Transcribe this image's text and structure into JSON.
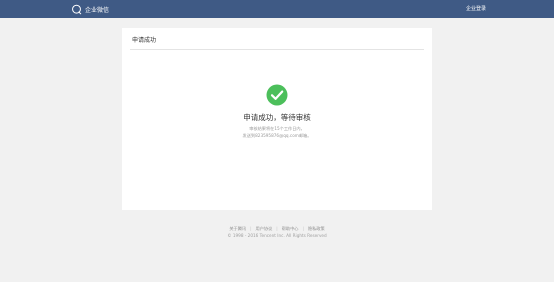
{
  "header": {
    "logo_text": "企业微信",
    "login_link": "企业登录",
    "logo_icon": "chat-bubble-icon",
    "background_color": "#3f5a85"
  },
  "card": {
    "title": "申请成功",
    "status_icon": "check-circle-icon",
    "status_color": "#4cbf5b",
    "success_title": "申请成功，等待审核",
    "description_line1": "审核结果将在15个工作日内，",
    "description_line2": "发送到823595876@qq.com邮箱。"
  },
  "footer": {
    "links": [
      {
        "label": "关于腾讯"
      },
      {
        "label": "用户协议"
      },
      {
        "label": "帮助中心"
      },
      {
        "label": "隐私政策"
      }
    ],
    "copyright": "© 1998 - 2016 Tencent Inc. All Rights Reserved"
  }
}
